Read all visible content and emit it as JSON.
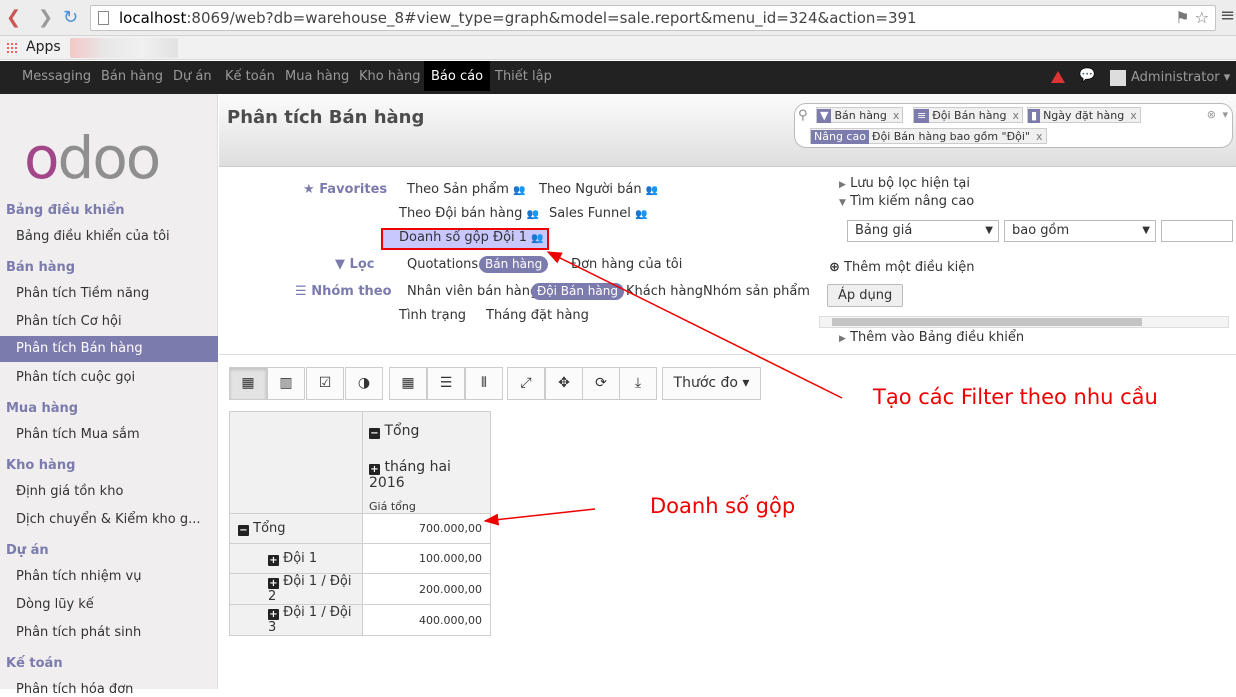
{
  "browser": {
    "url_host": "localhost",
    "url_rest": ":8069/web?db=warehouse_8#view_type=graph&model=sale.report&menu_id=324&action=391",
    "apps_label": "Apps"
  },
  "topnav": {
    "items": [
      "Messaging",
      "Bán hàng",
      "Dự án",
      "Kế toán",
      "Mua hàng",
      "Kho hàng",
      "Báo cáo",
      "Thiết lập"
    ],
    "active": "Báo cáo",
    "user": "Administrator"
  },
  "sidebar": {
    "sections": [
      {
        "title": "Bảng điều khiển",
        "items": [
          "Bảng điều khiển của tôi"
        ]
      },
      {
        "title": "Bán hàng",
        "items": [
          "Phân tích Tiềm năng",
          "Phân tích Cơ hội",
          "Phân tích Bán hàng",
          "Phân tích cuộc gọi"
        ]
      },
      {
        "title": "Mua hàng",
        "items": [
          "Phân tích Mua sắm"
        ]
      },
      {
        "title": "Kho hàng",
        "items": [
          "Định giá tồn kho",
          "Dịch chuyển & Kiểm kho g..."
        ]
      },
      {
        "title": "Dự án",
        "items": [
          "Phân tích nhiệm vụ",
          "Dòng lũy kế",
          "Phân tích phát sinh"
        ]
      },
      {
        "title": "Kế toán",
        "items": [
          "Phân tích hóa đơn"
        ]
      }
    ],
    "active_item": "Phân tích Bán hàng"
  },
  "header": {
    "title": "Phân tích Bán hàng",
    "facets": [
      {
        "value": "Bán hàng"
      },
      {
        "value": "Đội Bán hàng"
      },
      {
        "value": "Ngày đặt hàng"
      },
      {
        "label": "Nâng cao",
        "value": "Đội Bán hàng bao gồm \"Đội\""
      }
    ]
  },
  "filters": {
    "favorites_label": "Favorites",
    "favorites": [
      "Theo Sản phẩm",
      "Theo Người bán",
      "Theo Đội bán hàng",
      "Sales Funnel",
      "Doanh số gộp Đội 1"
    ],
    "filter_label": "Lọc",
    "filter_items": [
      "Quotations",
      "Bán hàng",
      "Đơn hàng của tôi"
    ],
    "groupby_label": "Nhóm theo",
    "groupby_items": [
      "Nhân viên bán hàng",
      "Đội Bán hàng",
      "Khách hàng",
      "Nhóm sản phẩm",
      "Tình trạng",
      "Tháng đặt hàng"
    ],
    "save_current": "Lưu bộ lọc hiện tại",
    "advanced": "Tìm kiếm nâng cao",
    "field_select": "Bảng giá",
    "operator_select": "bao gồm",
    "add_condition": "Thêm một điều kiện",
    "apply": "Áp dụng",
    "add_dashboard": "Thêm vào Bảng điều khiển"
  },
  "toolbar": {
    "measures": "Thước đo"
  },
  "pivot": {
    "col_total": "Tổng",
    "col_month": "tháng hai 2016",
    "measure": "Giá tổng",
    "rows": [
      {
        "label": "Tổng",
        "value": "700.000,00"
      },
      {
        "label": "Đội 1",
        "value": "100.000,00"
      },
      {
        "label": "Đội 1 / Đội 2",
        "value": "200.000,00"
      },
      {
        "label": "Đội 1 / Đội 3",
        "value": "400.000,00"
      }
    ]
  },
  "annotations": {
    "filter_note": "Tạo các Filter theo nhu cầu",
    "gross_note": "Doanh số gộp"
  },
  "colors": {
    "accent": "#7c7bad",
    "annotation": "#e00000",
    "navbar": "#222222"
  }
}
